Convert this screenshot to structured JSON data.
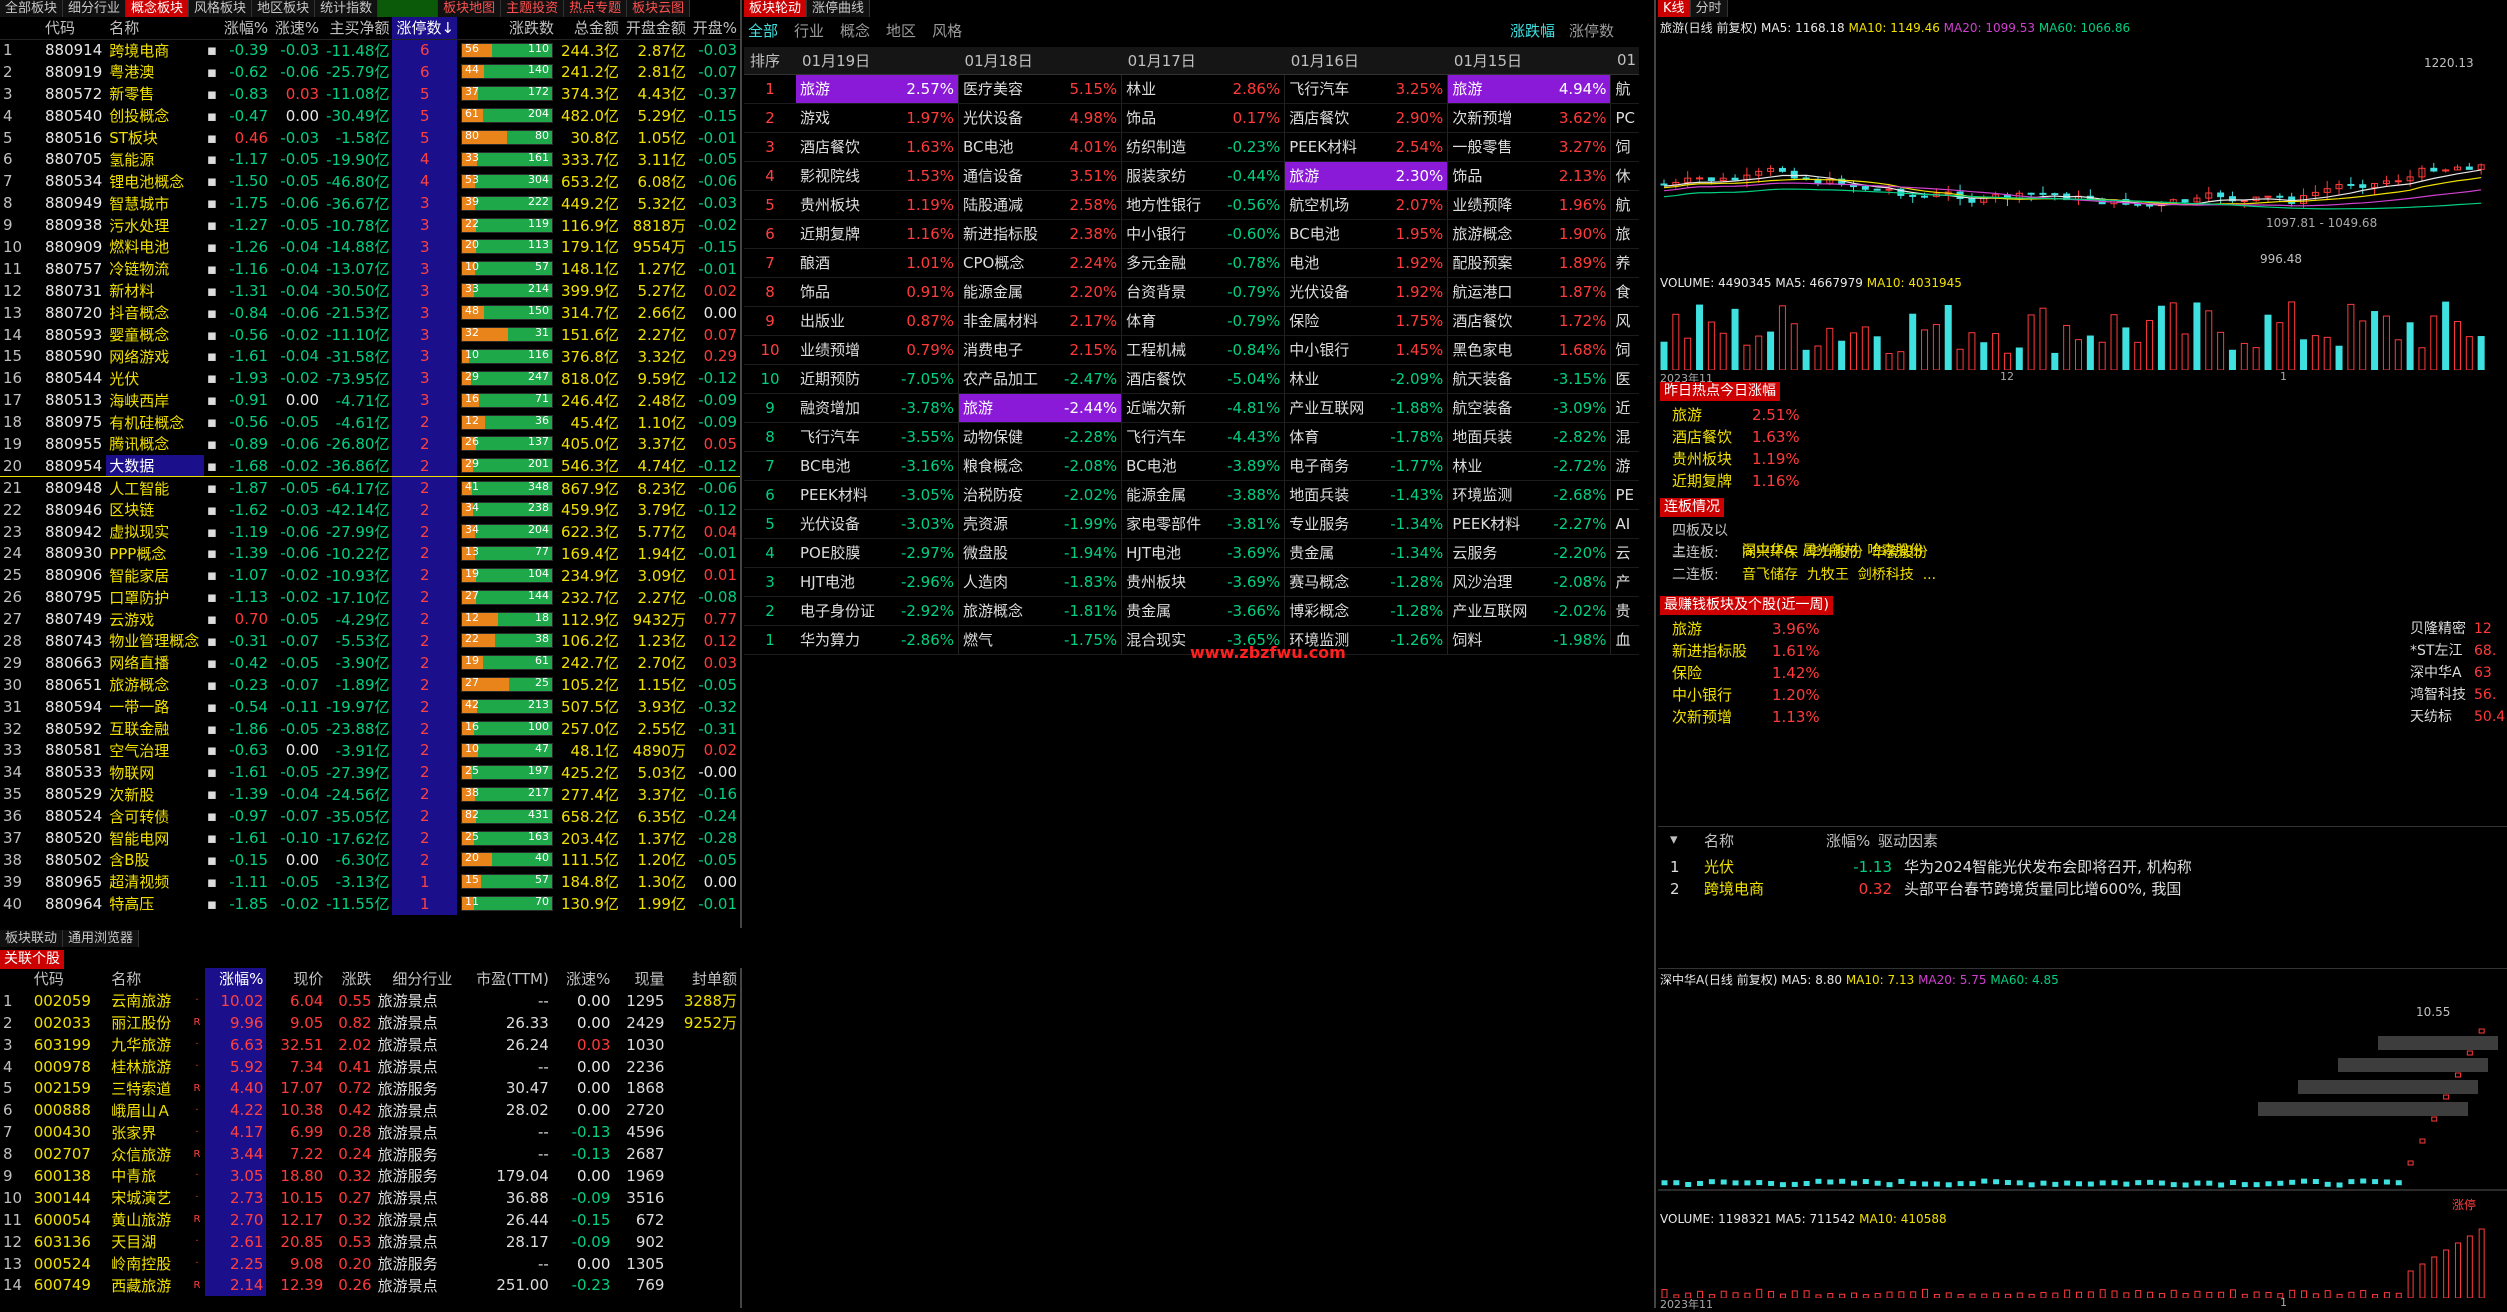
{
  "top_tabs_left": [
    "全部板块",
    "细分行业",
    "概念板块",
    "风格板块",
    "地区板块",
    "统计指数",
    "",
    "板块地图",
    "主题投资",
    "热点专题",
    "板块云图",
    "板块轮动",
    "涨停曲线"
  ],
  "left_table": {
    "headers": [
      "",
      "代码",
      "名称",
      "",
      "涨幅%",
      "涨速%",
      "主买净额",
      "涨停数↓",
      "涨跌数",
      "总金额",
      "开盘金额",
      "开盘%"
    ],
    "rows": [
      [
        "1",
        "880914",
        "跨境电商",
        "-0.39",
        "-0.03",
        "-11.48亿",
        "6",
        "56",
        "110",
        "244.3亿",
        "2.87亿",
        "-0.03"
      ],
      [
        "2",
        "880919",
        "粤港澳",
        "-0.62",
        "-0.06",
        "-25.79亿",
        "6",
        "44",
        "140",
        "241.2亿",
        "2.81亿",
        "-0.07"
      ],
      [
        "3",
        "880572",
        "新零售",
        "-0.83",
        "0.03",
        "-11.08亿",
        "5",
        "37",
        "172",
        "374.3亿",
        "4.43亿",
        "-0.37"
      ],
      [
        "4",
        "880540",
        "创投概念",
        "-0.47",
        "0.00",
        "-30.49亿",
        "5",
        "61",
        "204",
        "482.0亿",
        "5.29亿",
        "-0.15"
      ],
      [
        "5",
        "880516",
        "ST板块",
        "0.46",
        "-0.03",
        "-1.58亿",
        "5",
        "80",
        "80",
        "30.8亿",
        "1.05亿",
        "-0.01"
      ],
      [
        "6",
        "880705",
        "氢能源",
        "-1.17",
        "-0.05",
        "-19.90亿",
        "4",
        "33",
        "161",
        "333.7亿",
        "3.11亿",
        "-0.05"
      ],
      [
        "7",
        "880534",
        "锂电池概念",
        "-1.50",
        "-0.05",
        "-46.80亿",
        "4",
        "53",
        "304",
        "653.2亿",
        "6.08亿",
        "-0.06"
      ],
      [
        "8",
        "880949",
        "智慧城市",
        "-1.75",
        "-0.06",
        "-36.67亿",
        "3",
        "39",
        "222",
        "449.2亿",
        "5.32亿",
        "-0.03"
      ],
      [
        "9",
        "880938",
        "污水处理",
        "-1.27",
        "-0.05",
        "-10.78亿",
        "3",
        "22",
        "119",
        "116.9亿",
        "8818万",
        "-0.02"
      ],
      [
        "10",
        "880909",
        "燃料电池",
        "-1.26",
        "-0.04",
        "-14.88亿",
        "3",
        "20",
        "113",
        "179.1亿",
        "9554万",
        "-0.15"
      ],
      [
        "11",
        "880757",
        "冷链物流",
        "-1.16",
        "-0.04",
        "-13.07亿",
        "3",
        "10",
        "57",
        "148.1亿",
        "1.27亿",
        "-0.01"
      ],
      [
        "12",
        "880731",
        "新材料",
        "-1.31",
        "-0.04",
        "-30.50亿",
        "3",
        "33",
        "214",
        "399.9亿",
        "5.27亿",
        "0.02"
      ],
      [
        "13",
        "880720",
        "抖音概念",
        "-0.84",
        "-0.06",
        "-21.53亿",
        "3",
        "48",
        "150",
        "314.7亿",
        "2.66亿",
        "0.00"
      ],
      [
        "14",
        "880593",
        "婴童概念",
        "-0.56",
        "-0.02",
        "-11.10亿",
        "3",
        "32",
        "31",
        "151.6亿",
        "2.27亿",
        "0.07"
      ],
      [
        "15",
        "880590",
        "网络游戏",
        "-1.61",
        "-0.04",
        "-31.58亿",
        "3",
        "10",
        "116",
        "376.8亿",
        "3.32亿",
        "0.29"
      ],
      [
        "16",
        "880544",
        "光伏",
        "-1.93",
        "-0.02",
        "-73.95亿",
        "3",
        "29",
        "247",
        "818.0亿",
        "9.59亿",
        "-0.12"
      ],
      [
        "17",
        "880513",
        "海峡西岸",
        "-0.91",
        "0.00",
        "-4.71亿",
        "3",
        "16",
        "71",
        "246.4亿",
        "2.48亿",
        "-0.09"
      ],
      [
        "18",
        "880975",
        "有机硅概念",
        "-0.56",
        "-0.05",
        "-4.61亿",
        "2",
        "12",
        "36",
        "45.4亿",
        "1.10亿",
        "-0.09"
      ],
      [
        "19",
        "880955",
        "腾讯概念",
        "-0.89",
        "-0.06",
        "-26.80亿",
        "2",
        "26",
        "137",
        "405.0亿",
        "3.37亿",
        "0.05"
      ],
      [
        "20",
        "880954",
        "大数据",
        "-1.68",
        "-0.02",
        "-36.86亿",
        "2",
        "29",
        "201",
        "546.3亿",
        "4.74亿",
        "-0.12"
      ],
      [
        "21",
        "880948",
        "人工智能",
        "-1.87",
        "-0.05",
        "-64.17亿",
        "2",
        "41",
        "348",
        "867.9亿",
        "8.23亿",
        "-0.06"
      ],
      [
        "22",
        "880946",
        "区块链",
        "-1.62",
        "-0.03",
        "-42.14亿",
        "2",
        "34",
        "238",
        "459.9亿",
        "3.79亿",
        "-0.12"
      ],
      [
        "23",
        "880942",
        "虚拟现实",
        "-1.19",
        "-0.06",
        "-27.99亿",
        "2",
        "34",
        "204",
        "622.3亿",
        "5.77亿",
        "0.04"
      ],
      [
        "24",
        "880930",
        "PPP概念",
        "-1.39",
        "-0.06",
        "-10.22亿",
        "2",
        "13",
        "77",
        "169.4亿",
        "1.94亿",
        "-0.01"
      ],
      [
        "25",
        "880906",
        "智能家居",
        "-1.07",
        "-0.02",
        "-10.93亿",
        "2",
        "19",
        "104",
        "234.9亿",
        "3.09亿",
        "0.01"
      ],
      [
        "26",
        "880795",
        "口罩防护",
        "-1.13",
        "-0.02",
        "-17.10亿",
        "2",
        "27",
        "144",
        "232.7亿",
        "2.27亿",
        "-0.08"
      ],
      [
        "27",
        "880749",
        "云游戏",
        "0.70",
        "-0.05",
        "-4.29亿",
        "2",
        "12",
        "18",
        "112.9亿",
        "9432万",
        "0.77"
      ],
      [
        "28",
        "880743",
        "物业管理概念",
        "-0.31",
        "-0.07",
        "-5.53亿",
        "2",
        "22",
        "38",
        "106.2亿",
        "1.23亿",
        "0.12"
      ],
      [
        "29",
        "880663",
        "网络直播",
        "-0.42",
        "-0.05",
        "-3.90亿",
        "2",
        "19",
        "61",
        "242.7亿",
        "2.70亿",
        "0.03"
      ],
      [
        "30",
        "880651",
        "旅游概念",
        "-0.23",
        "-0.07",
        "-1.89亿",
        "2",
        "27",
        "25",
        "105.2亿",
        "1.15亿",
        "-0.05"
      ],
      [
        "31",
        "880594",
        "一带一路",
        "-0.54",
        "-0.11",
        "-19.97亿",
        "2",
        "42",
        "213",
        "507.5亿",
        "3.93亿",
        "-0.32"
      ],
      [
        "32",
        "880592",
        "互联金融",
        "-1.86",
        "-0.05",
        "-23.88亿",
        "2",
        "16",
        "100",
        "257.0亿",
        "2.55亿",
        "-0.31"
      ],
      [
        "33",
        "880581",
        "空气治理",
        "-0.63",
        "0.00",
        "-3.91亿",
        "2",
        "10",
        "47",
        "48.1亿",
        "4890万",
        "0.02"
      ],
      [
        "34",
        "880533",
        "物联网",
        "-1.61",
        "-0.05",
        "-27.39亿",
        "2",
        "25",
        "197",
        "425.2亿",
        "5.03亿",
        "-0.00"
      ],
      [
        "35",
        "880529",
        "次新股",
        "-1.39",
        "-0.04",
        "-24.56亿",
        "2",
        "38",
        "217",
        "277.4亿",
        "3.37亿",
        "-0.16"
      ],
      [
        "36",
        "880524",
        "含可转债",
        "-0.97",
        "-0.07",
        "-35.05亿",
        "2",
        "82",
        "431",
        "658.2亿",
        "6.35亿",
        "-0.24"
      ],
      [
        "37",
        "880520",
        "智能电网",
        "-1.61",
        "-0.10",
        "-17.62亿",
        "2",
        "25",
        "163",
        "203.4亿",
        "1.37亿",
        "-0.28"
      ],
      [
        "38",
        "880502",
        "含B股",
        "-0.15",
        "0.00",
        "-6.30亿",
        "2",
        "20",
        "40",
        "111.5亿",
        "1.20亿",
        "-0.05"
      ],
      [
        "39",
        "880965",
        "超清视频",
        "-1.11",
        "-0.05",
        "-3.13亿",
        "1",
        "15",
        "57",
        "184.8亿",
        "1.30亿",
        "0.00"
      ],
      [
        "40",
        "880964",
        "特高压",
        "-1.85",
        "-0.02",
        "-11.55亿",
        "1",
        "11",
        "70",
        "130.9亿",
        "1.99亿",
        "-0.01"
      ]
    ]
  },
  "mid_tabs": [
    "板块联动",
    "通用浏览器"
  ],
  "bottom": {
    "title": "关联个股",
    "headers": [
      "",
      "代码",
      "名称",
      "",
      "涨幅%",
      "现价",
      "涨跌",
      "细分行业",
      "市盈(TTM)",
      "涨速%",
      "现量",
      "封单额"
    ],
    "rows": [
      [
        "1",
        "002059",
        "云南旅游",
        "10.02",
        "6.04",
        "0.55",
        "旅游景点",
        "--",
        "0.00",
        "1295",
        "3288万"
      ],
      [
        "2",
        "002033",
        "丽江股份",
        "9.96",
        "9.05",
        "0.82",
        "旅游景点",
        "26.33",
        "0.00",
        "2429",
        "9252万"
      ],
      [
        "3",
        "603199",
        "九华旅游",
        "6.63",
        "32.51",
        "2.02",
        "旅游景点",
        "26.24",
        "0.03",
        "1030",
        ""
      ],
      [
        "4",
        "000978",
        "桂林旅游",
        "5.92",
        "7.34",
        "0.41",
        "旅游景点",
        "--",
        "0.00",
        "2236",
        ""
      ],
      [
        "5",
        "002159",
        "三特索道",
        "4.40",
        "17.07",
        "0.72",
        "旅游服务",
        "30.47",
        "0.00",
        "1868",
        ""
      ],
      [
        "6",
        "000888",
        "峨眉山Ａ",
        "4.22",
        "10.38",
        "0.42",
        "旅游景点",
        "28.02",
        "0.00",
        "2720",
        ""
      ],
      [
        "7",
        "000430",
        "张家界",
        "4.17",
        "6.99",
        "0.28",
        "旅游景点",
        "--",
        "-0.13",
        "4596",
        ""
      ],
      [
        "8",
        "002707",
        "众信旅游",
        "3.44",
        "7.22",
        "0.24",
        "旅游服务",
        "--",
        "-0.13",
        "2687",
        ""
      ],
      [
        "9",
        "600138",
        "中青旅",
        "3.05",
        "18.80",
        "0.32",
        "旅游服务",
        "179.04",
        "0.00",
        "1969",
        ""
      ],
      [
        "10",
        "300144",
        "宋城演艺",
        "2.73",
        "10.15",
        "0.27",
        "旅游景点",
        "36.88",
        "-0.09",
        "3516",
        ""
      ],
      [
        "11",
        "600054",
        "黄山旅游",
        "2.70",
        "12.17",
        "0.32",
        "旅游景点",
        "26.44",
        "-0.15",
        "672",
        ""
      ],
      [
        "12",
        "603136",
        "天目湖",
        "2.61",
        "20.85",
        "0.53",
        "旅游景点",
        "28.17",
        "-0.09",
        "902",
        ""
      ],
      [
        "13",
        "000524",
        "岭南控股",
        "2.25",
        "9.08",
        "0.20",
        "旅游服务",
        "--",
        "0.00",
        "1305",
        ""
      ],
      [
        "14",
        "600749",
        "西藏旅游",
        "2.14",
        "12.39",
        "0.26",
        "旅游景点",
        "251.00",
        "-0.23",
        "769",
        ""
      ]
    ]
  },
  "rotation": {
    "tabs": [
      "全部",
      "行业",
      "概念",
      "地区",
      "风格"
    ],
    "right_tabs": [
      "涨跌幅",
      "涨停数"
    ],
    "rank_header": "排序",
    "dates": [
      "01月19日",
      "01月18日",
      "01月17日",
      "01月16日",
      "01月15日",
      "01"
    ],
    "rows": [
      [
        "1",
        "旅游",
        "2.57%",
        "医疗美容",
        "5.15%",
        "林业",
        "2.86%",
        "飞行汽车",
        "3.25%",
        "旅游",
        "4.94%",
        "航"
      ],
      [
        "2",
        "游戏",
        "1.97%",
        "光伏设备",
        "4.98%",
        "饰品",
        "0.17%",
        "酒店餐饮",
        "2.90%",
        "次新预增",
        "3.62%",
        "PC"
      ],
      [
        "3",
        "酒店餐饮",
        "1.63%",
        "BC电池",
        "4.01%",
        "纺织制造",
        "-0.23%",
        "PEEK材料",
        "2.54%",
        "一般零售",
        "3.27%",
        "饲"
      ],
      [
        "4",
        "影视院线",
        "1.53%",
        "通信设备",
        "3.51%",
        "服装家纺",
        "-0.44%",
        "旅游",
        "2.30%",
        "饰品",
        "2.13%",
        "休"
      ],
      [
        "5",
        "贵州板块",
        "1.19%",
        "陆股通减",
        "2.58%",
        "地方性银行",
        "-0.56%",
        "航空机场",
        "2.07%",
        "业绩预降",
        "1.96%",
        "航"
      ],
      [
        "6",
        "近期复牌",
        "1.16%",
        "新进指标股",
        "2.38%",
        "中小银行",
        "-0.60%",
        "BC电池",
        "1.95%",
        "旅游概念",
        "1.90%",
        "旅"
      ],
      [
        "7",
        "酿酒",
        "1.01%",
        "CPO概念",
        "2.24%",
        "多元金融",
        "-0.78%",
        "电池",
        "1.92%",
        "配股预案",
        "1.89%",
        "养"
      ],
      [
        "8",
        "饰品",
        "0.91%",
        "能源金属",
        "2.20%",
        "台资背景",
        "-0.79%",
        "光伏设备",
        "1.92%",
        "航运港口",
        "1.87%",
        "食"
      ],
      [
        "9",
        "出版业",
        "0.87%",
        "非金属材料",
        "2.17%",
        "体育",
        "-0.79%",
        "保险",
        "1.75%",
        "酒店餐饮",
        "1.72%",
        "风"
      ],
      [
        "10",
        "业绩预增",
        "0.79%",
        "消费电子",
        "2.15%",
        "工程机械",
        "-0.84%",
        "中小银行",
        "1.45%",
        "黑色家电",
        "1.68%",
        "饲"
      ],
      [
        "10",
        "近期预防",
        "-7.05%",
        "农产品加工",
        "-2.47%",
        "酒店餐饮",
        "-5.04%",
        "林业",
        "-2.09%",
        "航天装备",
        "-3.15%",
        "医"
      ],
      [
        "9",
        "融资增加",
        "-3.78%",
        "旅游",
        "-2.44%",
        "近端次新",
        "-4.81%",
        "产业互联网",
        "-1.88%",
        "航空装备",
        "-3.09%",
        "近"
      ],
      [
        "8",
        "飞行汽车",
        "-3.55%",
        "动物保健",
        "-2.28%",
        "飞行汽车",
        "-4.43%",
        "体育",
        "-1.78%",
        "地面兵装",
        "-2.82%",
        "混"
      ],
      [
        "7",
        "BC电池",
        "-3.16%",
        "粮食概念",
        "-2.08%",
        "BC电池",
        "-3.89%",
        "电子商务",
        "-1.77%",
        "林业",
        "-2.72%",
        "游"
      ],
      [
        "6",
        "PEEK材料",
        "-3.05%",
        "治税防疫",
        "-2.02%",
        "能源金属",
        "-3.88%",
        "地面兵装",
        "-1.43%",
        "环境监测",
        "-2.68%",
        "PE"
      ],
      [
        "5",
        "光伏设备",
        "-3.03%",
        "壳资源",
        "-1.99%",
        "家电零部件",
        "-3.81%",
        "专业服务",
        "-1.34%",
        "PEEK材料",
        "-2.27%",
        "AI"
      ],
      [
        "4",
        "POE胶膜",
        "-2.97%",
        "微盘股",
        "-1.94%",
        "HJT电池",
        "-3.69%",
        "贵金属",
        "-1.34%",
        "云服务",
        "-2.20%",
        "云"
      ],
      [
        "3",
        "HJT电池",
        "-2.96%",
        "人造肉",
        "-1.83%",
        "贵州板块",
        "-3.69%",
        "赛马概念",
        "-1.28%",
        "风沙治理",
        "-2.08%",
        "产"
      ],
      [
        "2",
        "电子身份证",
        "-2.92%",
        "旅游概念",
        "-1.81%",
        "贵金属",
        "-3.66%",
        "博彩概念",
        "-1.28%",
        "产业互联网",
        "-2.02%",
        "贵"
      ],
      [
        "1",
        "华为算力",
        "-2.86%",
        "燃气",
        "-1.75%",
        "混合现实",
        "-3.65%",
        "环境监测",
        "-1.26%",
        "饲料",
        "-1.98%",
        "血"
      ]
    ],
    "selected_sector": "旅游",
    "watermark": "www.zbzfwu.com"
  },
  "right_top": {
    "tabs": [
      "K线",
      "分时"
    ],
    "title": "旅游(日线 前复权)",
    "ma": [
      "MA5: 1168.18",
      "MA10: 1149.46",
      "MA20: 1099.53",
      "MA60: 1066.86"
    ],
    "hi_label": "1220.13",
    "lo_label": "996.48",
    "mid_label": "1097.81 - 1049.68",
    "volume": [
      "VOLUME: 4490345",
      "MA5: 4667979",
      "MA10: 4031945"
    ],
    "xlabels": [
      "2023年11",
      "12",
      "1"
    ]
  },
  "hot": {
    "title": "昨日热点今日涨幅",
    "items": [
      [
        "旅游",
        "2.51%"
      ],
      [
        "酒店餐饮",
        "1.63%"
      ],
      [
        "贵州板块",
        "1.19%"
      ],
      [
        "近期复牌",
        "1.16%"
      ]
    ]
  },
  "lianban": {
    "title": "连板情况",
    "lines": [
      [
        "四板及以上:",
        "深中华A  晨光新材  哈森股份"
      ],
      [
        "三连板:",
        "同兴环保  华升股份  华瓷股份"
      ],
      [
        "二连板:",
        "音飞储存  九牧王  剑桥科技  ..."
      ]
    ]
  },
  "recent": {
    "title": "最赚钱板块及个股(近一周)",
    "sectors": [
      [
        "旅游",
        "3.96%"
      ],
      [
        "新进指标股",
        "1.61%"
      ],
      [
        "保险",
        "1.42%"
      ],
      [
        "中小银行",
        "1.20%"
      ],
      [
        "次新预增",
        "1.13%"
      ]
    ],
    "stocks": [
      [
        "贝隆精密",
        "12"
      ],
      [
        "*ST左江",
        "68."
      ],
      [
        "深中华A",
        "63"
      ],
      [
        "鸿智科技",
        "56."
      ],
      [
        "天纺标",
        "50.4"
      ]
    ]
  },
  "driver": {
    "headers": [
      "名称",
      "涨幅%",
      "驱动因素"
    ],
    "rows": [
      [
        "1",
        "光伏",
        "-1.13",
        "华为2024智能光伏发布会即将召开, 机构称"
      ],
      [
        "2",
        "跨境电商",
        "0.32",
        "头部平台春节跨境货量同比增600%, 我国"
      ]
    ]
  },
  "right_bottom": {
    "title": "深中华A(日线 前复权)",
    "ma": [
      "MA5: 8.80",
      "MA10: 7.13",
      "MA20: 5.75",
      "MA60: 4.85"
    ],
    "hi_label": "10.55",
    "vol": [
      "VOLUME: 1198321",
      "MA5: 711542",
      "MA10: 410588"
    ],
    "xlabels": [
      "2023年11",
      "1"
    ],
    "tag": "涨停"
  },
  "colors": {
    "up": "#ff3a3a",
    "down": "#00d080",
    "sel": "#8b1ad8",
    "limit": "#1b0f8c"
  }
}
